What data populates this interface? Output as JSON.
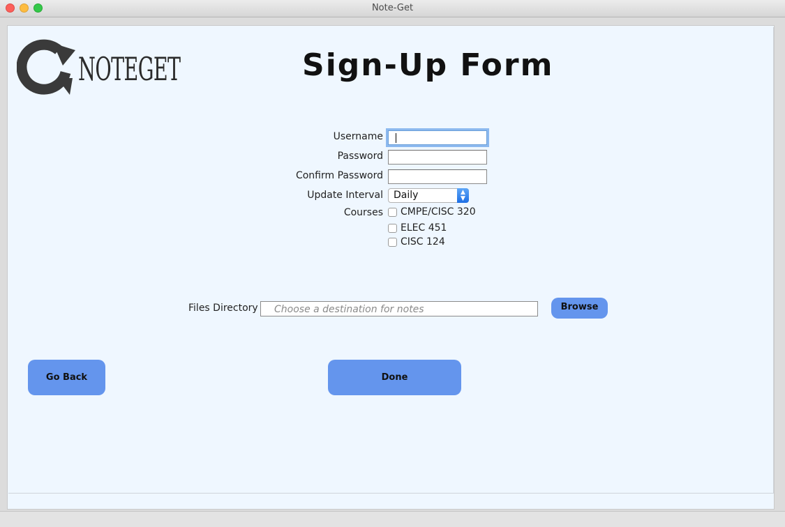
{
  "window": {
    "title": "Note-Get"
  },
  "logo": {
    "text": "NOTEGET"
  },
  "form": {
    "title": "Sign-Up Form",
    "username": {
      "label": "Username",
      "value": ""
    },
    "password": {
      "label": "Password",
      "value": ""
    },
    "confirm_password": {
      "label": "Confirm Password",
      "value": ""
    },
    "update_interval": {
      "label": "Update Interval",
      "selected": "Daily"
    },
    "courses": {
      "label": "Courses",
      "items": [
        {
          "label": "CMPE/CISC 320",
          "checked": false
        },
        {
          "label": "ELEC 451",
          "checked": false
        },
        {
          "label": "CISC 124",
          "checked": false
        }
      ]
    },
    "files_directory": {
      "label": "Files Directory",
      "placeholder": "Choose a destination for notes",
      "value": ""
    }
  },
  "buttons": {
    "browse": "Browse",
    "go_back": "Go Back",
    "done": "Done"
  },
  "colors": {
    "background": "#eff7ff",
    "button": "#6495ed",
    "focus_ring": "#8cb9ef"
  }
}
